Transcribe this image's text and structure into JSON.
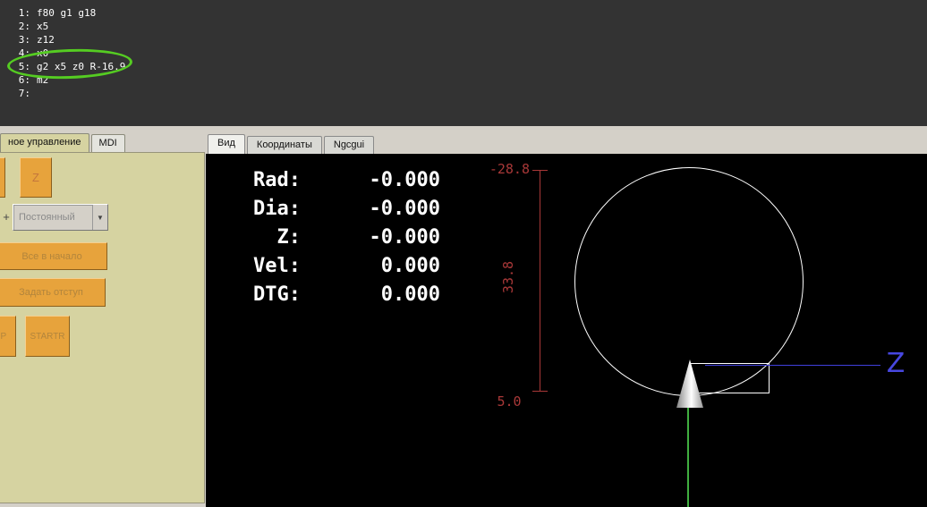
{
  "colors": {
    "gcode_bg": "#333333",
    "panel_beige": "#d6d3a1",
    "button_orange": "#e7a33c",
    "canvas_bg": "#000000",
    "dimension_red": "#a83838",
    "axis_blue": "#4040dd",
    "axis_green": "#3fae3f",
    "annotation_green": "#55cc22"
  },
  "gcode": {
    "lines": [
      {
        "num": "1:",
        "text": "f80 g1 g18"
      },
      {
        "num": "2:",
        "text": "x5"
      },
      {
        "num": "3:",
        "text": "z12"
      },
      {
        "num": "4:",
        "text": "x0"
      },
      {
        "num": "5:",
        "text": "g2 x5 z0 R-16.9"
      },
      {
        "num": "6:",
        "text": "m2"
      },
      {
        "num": "7:",
        "text": ""
      }
    ]
  },
  "left_panel": {
    "tabs": [
      {
        "label": "ное управление"
      },
      {
        "label": "MDI"
      }
    ],
    "z_button": "Z",
    "plus_label": "+",
    "feed_dropdown": {
      "value": "Постоянный"
    },
    "home_all_button": "Все в начало",
    "set_offset_button": "Задать отступ",
    "stop_button": "OP",
    "start_button": "STARTR"
  },
  "right_panel": {
    "tabs": [
      {
        "label": "Вид"
      },
      {
        "label": "Координаты"
      },
      {
        "label": "Ngcgui"
      }
    ],
    "readouts": [
      {
        "label": "Rad:",
        "value": "-0.000"
      },
      {
        "label": "Dia:",
        "value": "-0.000"
      },
      {
        "label": "Z:",
        "value": "-0.000"
      },
      {
        "label": "Vel:",
        "value": "0.000"
      },
      {
        "label": "DTG:",
        "value": "0.000"
      }
    ],
    "dimensions": {
      "top": "-28.8",
      "side": "33.8",
      "bottom": "5.0"
    },
    "z_axis_label": "Z"
  }
}
